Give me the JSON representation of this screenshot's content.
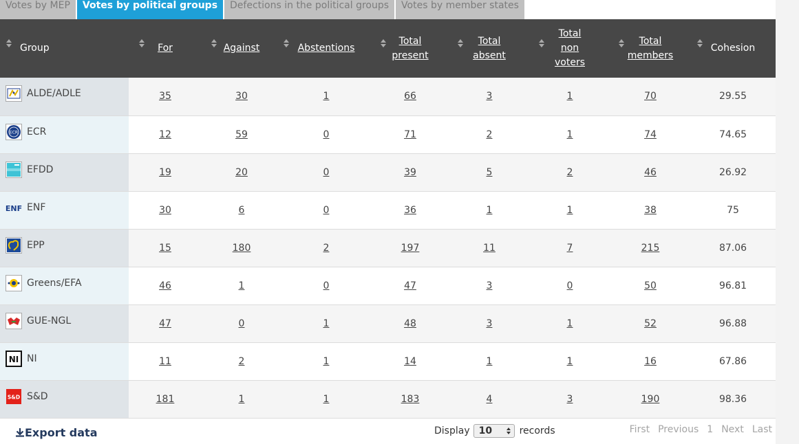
{
  "tabs": [
    "Votes by MEP",
    "Votes by political groups",
    "Defections in the political groups",
    "Votes by member states"
  ],
  "active_tab": 1,
  "headers": {
    "group": "Group",
    "for": "For",
    "against": "Against",
    "abstentions": "Abstentions",
    "total_present": [
      "Total",
      "present"
    ],
    "total_absent": [
      "Total",
      "absent"
    ],
    "total_non_voters": [
      "Total",
      "non",
      "voters"
    ],
    "total_members": [
      "Total",
      "members"
    ],
    "cohesion": "Cohesion"
  },
  "rows": [
    {
      "group": "ALDE/ADLE",
      "logo": "alde-logo",
      "for": "35",
      "against": "30",
      "abstentions": "1",
      "present": "66",
      "absent": "3",
      "non_voters": "1",
      "members": "70",
      "cohesion": "29.55"
    },
    {
      "group": "ECR",
      "logo": "ecr-logo",
      "for": "12",
      "against": "59",
      "abstentions": "0",
      "present": "71",
      "absent": "2",
      "non_voters": "1",
      "members": "74",
      "cohesion": "74.65"
    },
    {
      "group": "EFDD",
      "logo": "efdd-logo",
      "for": "19",
      "against": "20",
      "abstentions": "0",
      "present": "39",
      "absent": "5",
      "non_voters": "2",
      "members": "46",
      "cohesion": "26.92"
    },
    {
      "group": "ENF",
      "logo": "enf-logo",
      "for": "30",
      "against": "6",
      "abstentions": "0",
      "present": "36",
      "absent": "1",
      "non_voters": "1",
      "members": "38",
      "cohesion": "75"
    },
    {
      "group": "EPP",
      "logo": "epp-logo",
      "for": "15",
      "against": "180",
      "abstentions": "2",
      "present": "197",
      "absent": "11",
      "non_voters": "7",
      "members": "215",
      "cohesion": "87.06"
    },
    {
      "group": "Greens/EFA",
      "logo": "greens-logo",
      "for": "46",
      "against": "1",
      "abstentions": "0",
      "present": "47",
      "absent": "3",
      "non_voters": "0",
      "members": "50",
      "cohesion": "96.81"
    },
    {
      "group": "GUE-NGL",
      "logo": "gue-logo",
      "for": "47",
      "against": "0",
      "abstentions": "1",
      "present": "48",
      "absent": "3",
      "non_voters": "1",
      "members": "52",
      "cohesion": "96.88"
    },
    {
      "group": "NI",
      "logo": "ni-logo",
      "for": "11",
      "against": "2",
      "abstentions": "1",
      "present": "14",
      "absent": "1",
      "non_voters": "1",
      "members": "16",
      "cohesion": "67.86"
    },
    {
      "group": "S&D",
      "logo": "sd-logo",
      "for": "181",
      "against": "1",
      "abstentions": "1",
      "present": "183",
      "absent": "4",
      "non_voters": "3",
      "members": "190",
      "cohesion": "98.36"
    }
  ],
  "logo_text": {
    "enf": "ENF",
    "ni": "NI",
    "sd": "S&D",
    "ecr": "ECR"
  },
  "footer": {
    "export_label": "Export data",
    "display_label": "Display",
    "display_value": "10",
    "records_label": "records",
    "pager": [
      "First",
      "Previous",
      "1",
      "Next",
      "Last"
    ]
  },
  "colors": {
    "active_tab": "#1ea0d8",
    "header_bg": "#474747",
    "tab_bg": "#c0c0c0"
  }
}
